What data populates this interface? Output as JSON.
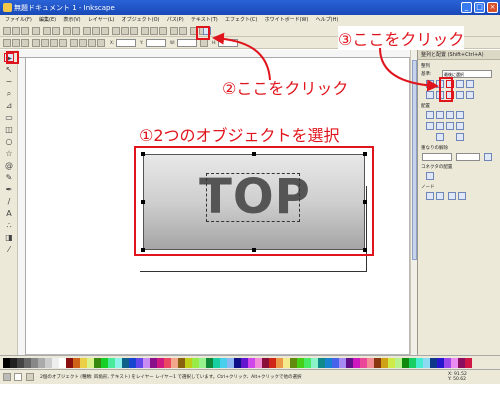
{
  "window": {
    "title": "無題ドキュメント 1 - Inkscape",
    "buttons": {
      "minimize": "_",
      "maximize": "□",
      "close": "×"
    }
  },
  "menubar": {
    "items": [
      "ファイル(F)",
      "編集(E)",
      "表示(V)",
      "レイヤー(L)",
      "オブジェクト(O)",
      "パス(P)",
      "テキスト(T)",
      "エフェクト(C)",
      "ホワイトボード(W)",
      "ヘルプ(H)"
    ]
  },
  "toolbar2": {
    "x_label": "X:",
    "x_value": "",
    "y_label": "Y:",
    "y_value": "",
    "w_label": "W:",
    "w_value": "",
    "h_label": "H:",
    "h_value": ""
  },
  "right_panel": {
    "title": "整列と配置 (Shift+Ctrl+A)",
    "section_align": "整列",
    "relative_label": "基準:",
    "relative_value": "最後に選択",
    "section_distribute": "配置",
    "section_connector": "コネクタの配置",
    "section_random": "重なりの解除",
    "section_nodes": "ノード"
  },
  "canvas": {
    "object_text": "TOP"
  },
  "annotations": {
    "step1": "①2つのオブジェクトを選択",
    "step2": "②ここをクリック",
    "step3": "③ここをクリック",
    "color": "#e0141c"
  },
  "statusbar": {
    "message": "2個のオブジェクト (種類: 四角形, テキスト) をレイヤー レイヤー1 で選択しています。Ctrl+クリック、Alt+クリックで他の選択",
    "coords_x": "X: 91.52",
    "coords_y": "Y: 50.62"
  }
}
